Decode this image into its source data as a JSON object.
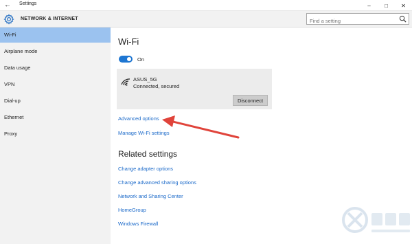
{
  "window": {
    "title": "Settings",
    "controls": [
      "minimize-icon",
      "maximize-icon",
      "close-icon"
    ]
  },
  "header": {
    "title": "NETWORK & INTERNET",
    "icon": "gear-icon"
  },
  "search": {
    "placeholder": "Find a setting",
    "icon": "search-icon"
  },
  "sidebar": {
    "items": [
      {
        "label": "Wi-Fi",
        "active": true
      },
      {
        "label": "Airplane mode",
        "active": false
      },
      {
        "label": "Data usage",
        "active": false
      },
      {
        "label": "VPN",
        "active": false
      },
      {
        "label": "Dial-up",
        "active": false
      },
      {
        "label": "Ethernet",
        "active": false
      },
      {
        "label": "Proxy",
        "active": false
      }
    ]
  },
  "main": {
    "title": "Wi-Fi",
    "toggle": {
      "state": "On",
      "on": true
    },
    "network": {
      "name": "ASUS_5G",
      "status": "Connected, secured",
      "icon": "wifi-signal-icon",
      "button": "Disconnect"
    },
    "links": {
      "advanced": "Advanced options",
      "manage": "Manage Wi-Fi settings"
    },
    "related": {
      "title": "Related settings",
      "links": [
        "Change adapter options",
        "Change advanced sharing options",
        "Network and Sharing Center",
        "HomeGroup",
        "Windows Firewall"
      ]
    }
  },
  "colors": {
    "accent": "#1e76d2",
    "link": "#1a69c9",
    "sidebar_selected": "#9bc2ef",
    "sidebar_bg": "#f2f2f2",
    "annotation_arrow": "#e0443b"
  }
}
